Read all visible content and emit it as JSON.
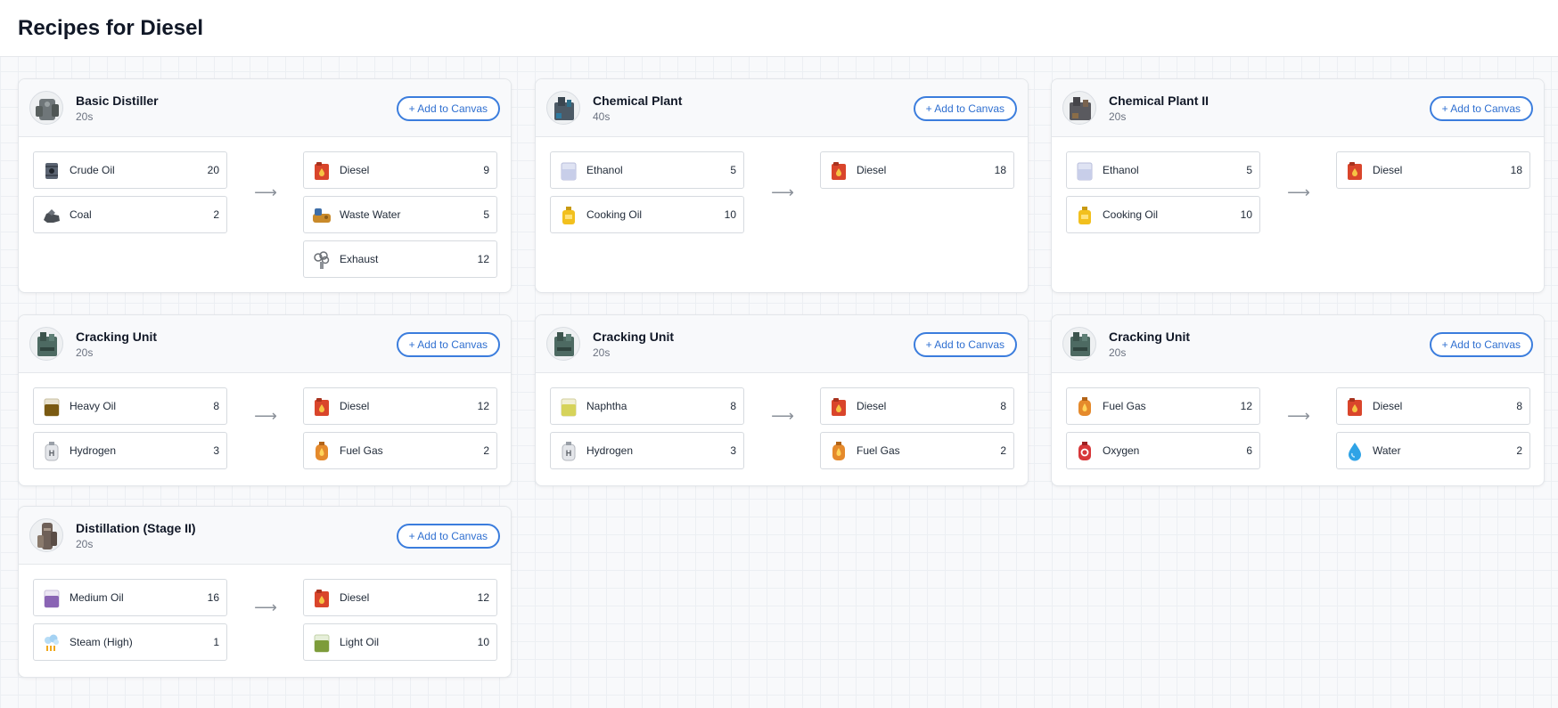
{
  "page": {
    "title": "Recipes for Diesel"
  },
  "add_label": "+ Add to Canvas",
  "colors": {
    "accent": "#3b7ddd",
    "card_border": "#e3e6ea"
  },
  "recipes": [
    {
      "machine": "Basic Distiller",
      "machine_icon": "basic-distiller-icon",
      "time": "20s",
      "inputs": [
        {
          "name": "Crude Oil",
          "qty": "20",
          "icon": "crude-oil-icon"
        },
        {
          "name": "Coal",
          "qty": "2",
          "icon": "coal-icon"
        }
      ],
      "outputs": [
        {
          "name": "Diesel",
          "qty": "9",
          "icon": "diesel-icon"
        },
        {
          "name": "Waste Water",
          "qty": "5",
          "icon": "waste-water-icon"
        },
        {
          "name": "Exhaust",
          "qty": "12",
          "icon": "exhaust-icon"
        }
      ]
    },
    {
      "machine": "Chemical Plant",
      "machine_icon": "chemical-plant-icon",
      "time": "40s",
      "inputs": [
        {
          "name": "Ethanol",
          "qty": "5",
          "icon": "ethanol-icon"
        },
        {
          "name": "Cooking Oil",
          "qty": "10",
          "icon": "cooking-oil-icon"
        }
      ],
      "outputs": [
        {
          "name": "Diesel",
          "qty": "18",
          "icon": "diesel-icon"
        }
      ]
    },
    {
      "machine": "Chemical Plant II",
      "machine_icon": "chemical-plant-ii-icon",
      "time": "20s",
      "inputs": [
        {
          "name": "Ethanol",
          "qty": "5",
          "icon": "ethanol-icon"
        },
        {
          "name": "Cooking Oil",
          "qty": "10",
          "icon": "cooking-oil-icon"
        }
      ],
      "outputs": [
        {
          "name": "Diesel",
          "qty": "18",
          "icon": "diesel-icon"
        }
      ]
    },
    {
      "machine": "Cracking Unit",
      "machine_icon": "cracking-unit-icon",
      "time": "20s",
      "inputs": [
        {
          "name": "Heavy Oil",
          "qty": "8",
          "icon": "heavy-oil-icon"
        },
        {
          "name": "Hydrogen",
          "qty": "3",
          "icon": "hydrogen-icon"
        }
      ],
      "outputs": [
        {
          "name": "Diesel",
          "qty": "12",
          "icon": "diesel-icon"
        },
        {
          "name": "Fuel Gas",
          "qty": "2",
          "icon": "fuel-gas-icon"
        }
      ]
    },
    {
      "machine": "Cracking Unit",
      "machine_icon": "cracking-unit-icon",
      "time": "20s",
      "inputs": [
        {
          "name": "Naphtha",
          "qty": "8",
          "icon": "naphtha-icon"
        },
        {
          "name": "Hydrogen",
          "qty": "3",
          "icon": "hydrogen-icon"
        }
      ],
      "outputs": [
        {
          "name": "Diesel",
          "qty": "8",
          "icon": "diesel-icon"
        },
        {
          "name": "Fuel Gas",
          "qty": "2",
          "icon": "fuel-gas-icon"
        }
      ]
    },
    {
      "machine": "Cracking Unit",
      "machine_icon": "cracking-unit-icon",
      "time": "20s",
      "inputs": [
        {
          "name": "Fuel Gas",
          "qty": "12",
          "icon": "fuel-gas-icon"
        },
        {
          "name": "Oxygen",
          "qty": "6",
          "icon": "oxygen-icon"
        }
      ],
      "outputs": [
        {
          "name": "Diesel",
          "qty": "8",
          "icon": "diesel-icon"
        },
        {
          "name": "Water",
          "qty": "2",
          "icon": "water-icon"
        }
      ]
    },
    {
      "machine": "Distillation (Stage II)",
      "machine_icon": "distillation-stage-ii-icon",
      "time": "20s",
      "inputs": [
        {
          "name": "Medium Oil",
          "qty": "16",
          "icon": "medium-oil-icon"
        },
        {
          "name": "Steam (High)",
          "qty": "1",
          "icon": "steam-high-icon"
        }
      ],
      "outputs": [
        {
          "name": "Diesel",
          "qty": "12",
          "icon": "diesel-icon"
        },
        {
          "name": "Light Oil",
          "qty": "10",
          "icon": "light-oil-icon"
        }
      ]
    }
  ]
}
